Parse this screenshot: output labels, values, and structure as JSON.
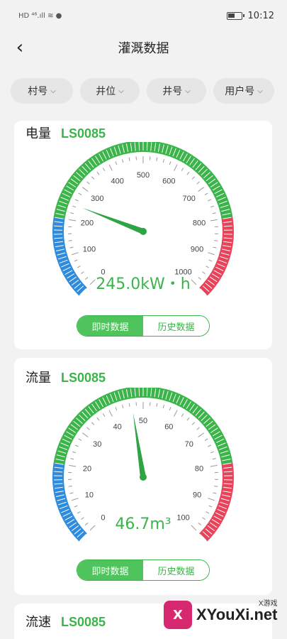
{
  "status": {
    "left": "HD ⁴⁶.ıll ≋ ●",
    "time": "10:12"
  },
  "navbar": {
    "back": "‹",
    "title": "灌溉数据"
  },
  "filters": [
    {
      "label": "村号"
    },
    {
      "label": "井位"
    },
    {
      "label": "井号"
    },
    {
      "label": "用户号"
    }
  ],
  "cards": [
    {
      "name": "电量",
      "code": "LS0085",
      "gauge": {
        "min": 0,
        "max": 1000,
        "value": 245.0,
        "ticks": [
          "0",
          "100",
          "200",
          "300",
          "400",
          "500",
          "600",
          "700",
          "800",
          "900",
          "1000"
        ]
      },
      "reading": "245.0kW・h",
      "tabs": {
        "active": "即时数据",
        "other": "历史数据"
      }
    },
    {
      "name": "流量",
      "code": "LS0085",
      "gauge": {
        "min": 0,
        "max": 100,
        "value": 46.7,
        "ticks": [
          "0",
          "10",
          "20",
          "30",
          "40",
          "50",
          "60",
          "70",
          "80",
          "90",
          "100"
        ]
      },
      "reading": "46.7m³",
      "tabs": {
        "active": "即时数据",
        "other": "历史数据"
      }
    },
    {
      "name": "流速",
      "code": "LS0085"
    }
  ],
  "colors": {
    "green": "#3bb44a",
    "blue": "#2f8bdc",
    "red": "#e8435b"
  },
  "watermark": {
    "logo": "X",
    "text": "XYouXi.net",
    "small": "X游戏"
  }
}
